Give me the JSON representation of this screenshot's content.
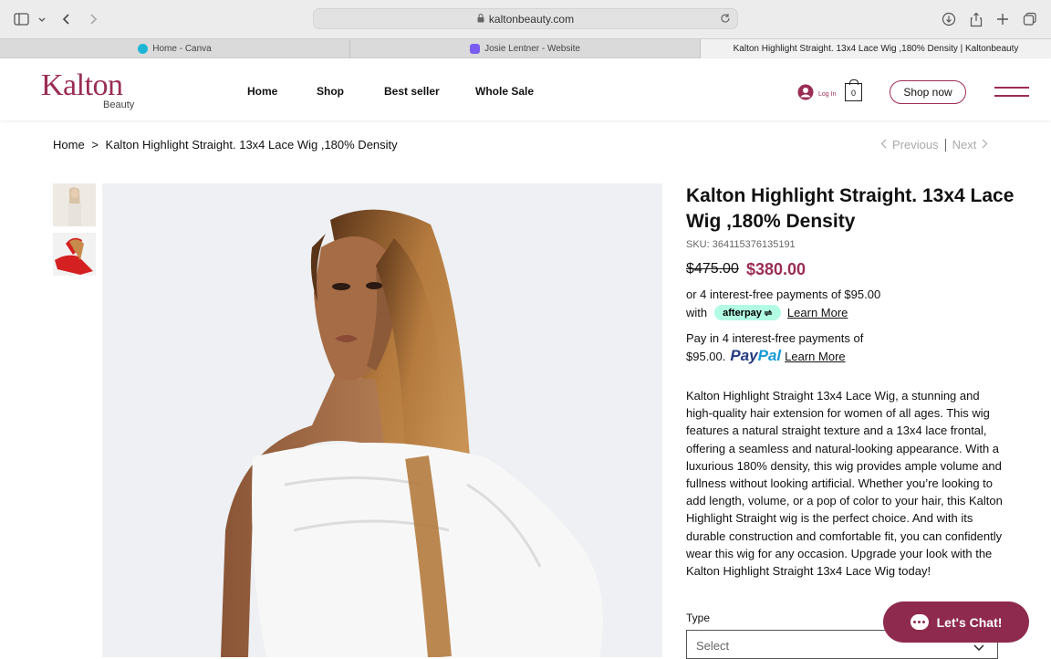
{
  "browser": {
    "url": "kaltonbeauty.com",
    "tabs": [
      {
        "label": "Home - Canva",
        "favicon_color": "#1fb6d6",
        "active": false
      },
      {
        "label": "Josie Lentner - Website",
        "favicon_color": "#7b5cf0",
        "active": false
      },
      {
        "label": "Kalton Highlight Straight. 13x4 Lace Wig ,180% Density | Kaltonbeauty",
        "active": true
      }
    ]
  },
  "header": {
    "logo_main": "Kalton",
    "logo_sub": "Beauty",
    "nav": [
      "Home",
      "Shop",
      "Best seller",
      "Whole Sale"
    ],
    "login_label": "Log In",
    "cart_count": "0",
    "shop_now": "Shop now",
    "brand_color": "#9b2d55"
  },
  "breadcrumb": {
    "home": "Home",
    "separator": ">",
    "current": "Kalton Highlight Straight. 13x4 Lace Wig ,180% Density"
  },
  "pager": {
    "previous": "Previous",
    "next": "Next"
  },
  "product": {
    "title": "Kalton Highlight Straight. 13x4 Lace Wig ,180% Density",
    "sku": "SKU: 364115376135191",
    "old_price": "$475.00",
    "price": "$380.00",
    "afterpay_line1": "or 4 interest-free payments of $95.00",
    "afterpay_with": "with",
    "afterpay_badge": "afterpay",
    "afterpay_learn": "Learn More",
    "paypal_line1": "Pay in 4 interest-free payments of",
    "paypal_amount": "$95.00.",
    "paypal_pay": "Pay",
    "paypal_pal": "Pal",
    "paypal_learn": "Learn More",
    "description": "Kalton Highlight Straight 13x4 Lace Wig, a stunning and high-quality hair extension for women of all ages. This wig features a natural straight texture and a 13x4 lace frontal, offering a seamless and natural-looking appearance. With a luxurious 180% density, this wig provides ample volume and fullness without looking artificial. Whether you’re looking to add length, volume, or a pop of color to your hair, this Kalton Highlight Straight wig is the perfect choice. And with its durable construction and comfortable fit, you can confidently wear this wig for any occasion. Upgrade your look with the Kalton Highlight Straight 13x4 Lace Wig today!",
    "type_label": "Type",
    "type_placeholder": "Select"
  },
  "chat": {
    "label": "Let's Chat!"
  }
}
